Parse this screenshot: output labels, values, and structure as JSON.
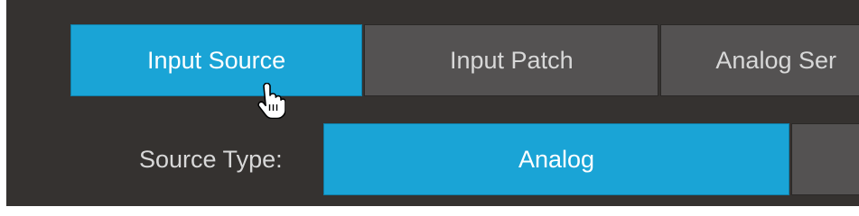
{
  "tabs": [
    {
      "label": "Input Source",
      "active": true
    },
    {
      "label": "Input Patch",
      "active": false
    },
    {
      "label": "Analog Ser",
      "active": false
    }
  ],
  "source_type": {
    "label": "Source Type:",
    "options": [
      {
        "label": "Analog",
        "active": true
      },
      {
        "label": "",
        "active": false
      }
    ]
  },
  "colors": {
    "panel_bg": "#353230",
    "active_accent": "#1aa4d6",
    "inactive_button": "#545252",
    "text_light": "#d8d8d8"
  },
  "cursor": {
    "icon": "hand-pointer-icon"
  }
}
